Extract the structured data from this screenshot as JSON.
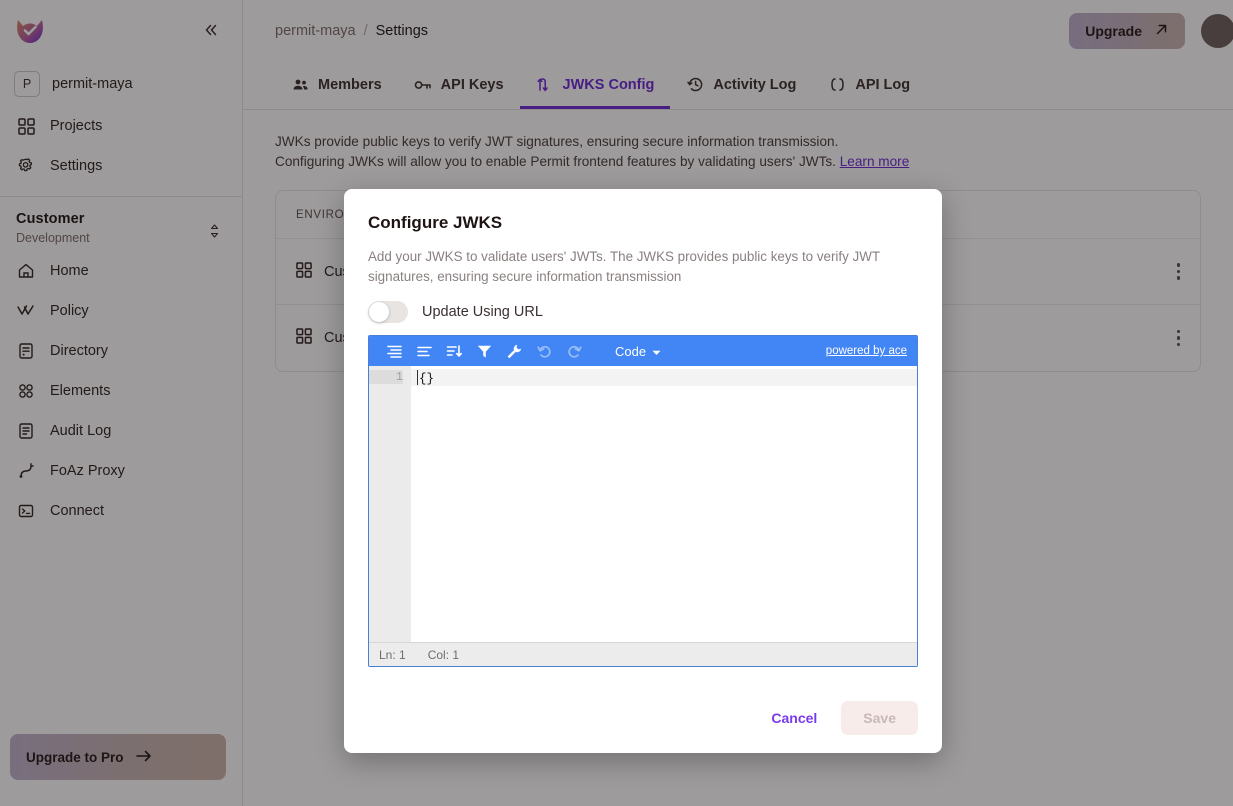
{
  "sidebar": {
    "logo_icon": "permit-logo",
    "collapse_icon": "chevrons-left-icon",
    "org": {
      "badge": "P",
      "name": "permit-maya"
    },
    "top_items": [
      {
        "label": "Projects",
        "icon": "grid-icon"
      },
      {
        "label": "Settings",
        "icon": "gear-icon"
      }
    ],
    "env": {
      "title": "Customer",
      "subtitle": "Development",
      "selector_icon": "chevron-updown-icon"
    },
    "nav_items": [
      {
        "label": "Home",
        "icon": "home-icon"
      },
      {
        "label": "Policy",
        "icon": "policy-icon"
      },
      {
        "label": "Directory",
        "icon": "directory-icon"
      },
      {
        "label": "Elements",
        "icon": "elements-icon"
      },
      {
        "label": "Audit Log",
        "icon": "audit-log-icon"
      },
      {
        "label": "FoAz Proxy",
        "icon": "foaz-proxy-icon"
      },
      {
        "label": "Connect",
        "icon": "terminal-icon"
      }
    ],
    "upgrade_pro": {
      "label": "Upgrade to Pro",
      "icon": "arrow-right-icon"
    }
  },
  "topbar": {
    "breadcrumb": {
      "root": "permit-maya",
      "separator": "/",
      "current": "Settings"
    },
    "upgrade": {
      "label": "Upgrade",
      "icon": "arrow-up-right-icon"
    }
  },
  "tabs": [
    {
      "label": "Members",
      "icon": "people-icon",
      "active": false
    },
    {
      "label": "API Keys",
      "icon": "key-icon",
      "active": false
    },
    {
      "label": "JWKS Config",
      "icon": "jwks-icon",
      "active": true
    },
    {
      "label": "Activity Log",
      "icon": "clock-history-icon",
      "active": false
    },
    {
      "label": "API Log",
      "icon": "code-brackets-icon",
      "active": false
    }
  ],
  "description": {
    "line1": "JWKs provide public keys to verify JWT signatures, ensuring secure information transmission.",
    "line2": "Configuring JWKs will allow you to enable Permit frontend features by validating users' JWTs.",
    "link": "Learn more"
  },
  "table": {
    "header": "ENVIRONMENT",
    "rows": [
      {
        "name": "Customer",
        "icon": "grid-icon",
        "menu_icon": "kebab-menu-icon"
      },
      {
        "name": "Customer",
        "icon": "grid-icon",
        "menu_icon": "kebab-menu-icon"
      }
    ]
  },
  "modal": {
    "title": "Configure JWKS",
    "description": "Add your JWKS to validate users' JWTs. The JWKS provides public keys to verify JWT signatures, ensuring secure information transmission",
    "toggle": {
      "label": "Update Using URL",
      "on": false
    },
    "editor": {
      "toolbar_icons": [
        "format-indent-icon",
        "format-align-icon",
        "sort-icon",
        "filter-funnel-icon",
        "wrench-icon",
        "undo-icon",
        "redo-icon"
      ],
      "mode_label": "Code",
      "mode_caret_icon": "caret-down-icon",
      "powered_by": "powered by ace",
      "line_number": "1",
      "content": "{}",
      "status_ln": "Ln: 1",
      "status_col": "Col: 1"
    },
    "cancel_label": "Cancel",
    "save_label": "Save"
  },
  "colors": {
    "accent": "#6d28d9",
    "editor_toolbar": "#4285f4",
    "save_disabled_bg": "#f7ecea"
  }
}
